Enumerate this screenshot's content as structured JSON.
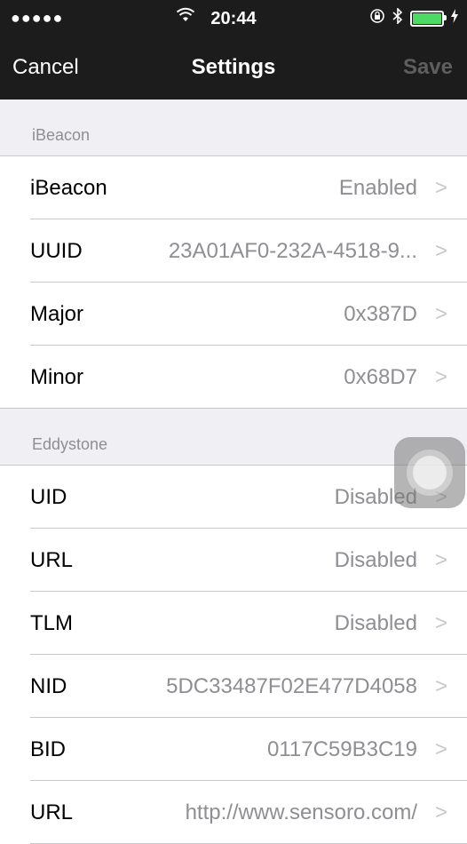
{
  "status_bar": {
    "signal": "●●●●●",
    "wifi_icon": "wifi-icon",
    "time": "20:44",
    "battery_color": "#4cd964"
  },
  "nav": {
    "cancel_label": "Cancel",
    "title": "Settings",
    "save_label": "Save"
  },
  "sections": {
    "ibeacon": {
      "header": "iBeacon",
      "rows": [
        {
          "label": "iBeacon",
          "value": "Enabled"
        },
        {
          "label": "UUID",
          "value": "23A01AF0-232A-4518-9..."
        },
        {
          "label": "Major",
          "value": "0x387D"
        },
        {
          "label": "Minor",
          "value": "0x68D7"
        }
      ]
    },
    "eddystone": {
      "header": "Eddystone",
      "rows": [
        {
          "label": "UID",
          "value": "Disabled"
        },
        {
          "label": "URL",
          "value": "Disabled"
        },
        {
          "label": "TLM",
          "value": "Disabled"
        },
        {
          "label": "NID",
          "value": "5DC33487F02E477D4058"
        },
        {
          "label": "BID",
          "value": "0117C59B3C19"
        },
        {
          "label": "URL",
          "value": "http://www.sensoro.com/"
        }
      ]
    }
  },
  "chevron": ">"
}
